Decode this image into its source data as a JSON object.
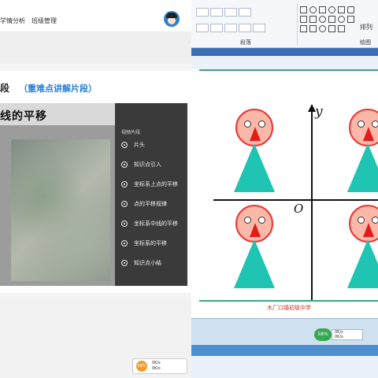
{
  "left_panel": {
    "nav": {
      "item1": "学情分析",
      "item2": "班级管理"
    },
    "section": {
      "title": "段",
      "subtitle": "（重难点讲解片段）"
    },
    "video": {
      "banner": "线的平移",
      "playlist_title": "视频片段",
      "items": [
        "片头",
        "知识点引入",
        "坐标系上点的平移",
        "点的平移规律",
        "坐标系中线的平移",
        "坐标系的平移",
        "知识点小结"
      ]
    },
    "status_chip": {
      "badge": "58%",
      "line1": "0K/s",
      "line2": "0K/s"
    }
  },
  "right_panel": {
    "ribbon": {
      "group_paragraph": "段落",
      "group_draw": "绘图",
      "arrange_label": "排列"
    },
    "slide": {
      "y_label": "y",
      "origin_label": "O",
      "footer": "木厂口镇初级中学"
    },
    "status": {
      "badge": "58%",
      "line1": "0K/s",
      "line2": "0K/s"
    }
  },
  "colors": {
    "figure_body": "#1fc4b3",
    "figure_face": "#fbb8a8",
    "rule": "#3aa87a",
    "link": "#2a7dd1"
  }
}
